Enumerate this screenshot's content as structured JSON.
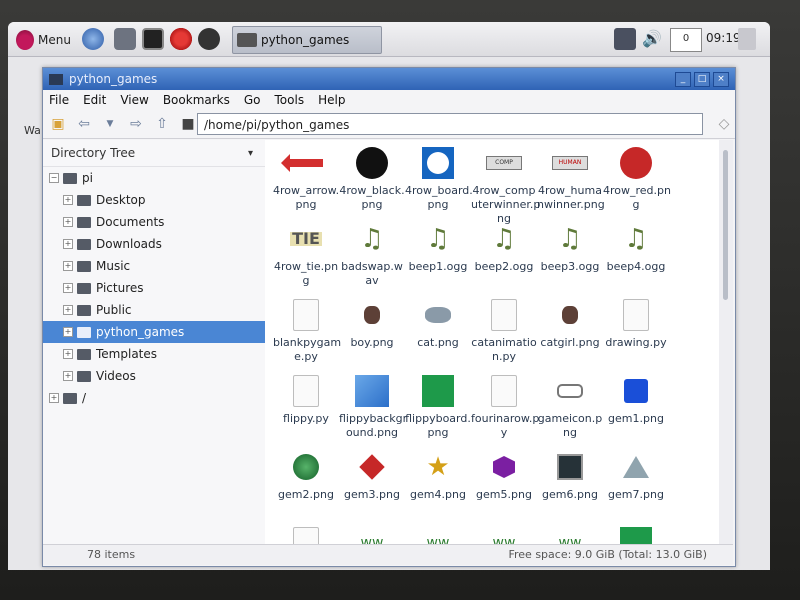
{
  "panel": {
    "menu_label": "Menu",
    "task_label": "python_games",
    "clock": "09:19",
    "tray_badge": "0"
  },
  "window": {
    "title": "python_games",
    "menu": [
      "File",
      "Edit",
      "View",
      "Bookmarks",
      "Go",
      "Tools",
      "Help"
    ],
    "path": "/home/pi/python_games"
  },
  "sidebar": {
    "header": "Directory Tree",
    "root": "pi",
    "items": [
      "Desktop",
      "Documents",
      "Downloads",
      "Music",
      "Pictures",
      "Public",
      "python_games",
      "Templates",
      "Videos"
    ],
    "fs_root": "/"
  },
  "files": [
    {
      "name": "4row_arrow.\npng",
      "icon": "arrow"
    },
    {
      "name": "4row_black.\npng",
      "icon": "black-circle"
    },
    {
      "name": "4row_board.\npng",
      "icon": "board"
    },
    {
      "name": "4row_comp\nuterwinner.p\nng",
      "icon": "banner"
    },
    {
      "name": "4row_huma\nnwinner.png",
      "icon": "banner2"
    },
    {
      "name": "4row_red.pn\ng",
      "icon": "red-circle"
    },
    {
      "name": "4row_tie.pn\ng",
      "icon": "tie"
    },
    {
      "name": "badswap.w\nav",
      "icon": "audio"
    },
    {
      "name": "beep1.ogg",
      "icon": "audio"
    },
    {
      "name": "beep2.ogg",
      "icon": "audio"
    },
    {
      "name": "beep3.ogg",
      "icon": "audio"
    },
    {
      "name": "beep4.ogg",
      "icon": "audio"
    },
    {
      "name": "blankpygam\ne.py",
      "icon": "doc"
    },
    {
      "name": "boy.png",
      "icon": "sprite"
    },
    {
      "name": "cat.png",
      "icon": "cat"
    },
    {
      "name": "catanimatio\nn.py",
      "icon": "doc"
    },
    {
      "name": "catgirl.png",
      "icon": "sprite"
    },
    {
      "name": "drawing.py",
      "icon": "doc"
    },
    {
      "name": "flippy.py",
      "icon": "doc"
    },
    {
      "name": "flippybackgr\nound.png",
      "icon": "blue-square"
    },
    {
      "name": "flippyboard.\npng",
      "icon": "green-square"
    },
    {
      "name": "fourinarow.p\ny",
      "icon": "doc"
    },
    {
      "name": "gameicon.p\nng",
      "icon": "gameicon"
    },
    {
      "name": "gem1.png",
      "icon": "gem-blue"
    },
    {
      "name": "gem2.png",
      "icon": "gem-green"
    },
    {
      "name": "gem3.png",
      "icon": "gem-red"
    },
    {
      "name": "gem4.png",
      "icon": "gem-star"
    },
    {
      "name": "gem5.png",
      "icon": "gem-purple"
    },
    {
      "name": "gem6.png",
      "icon": "gem-dark"
    },
    {
      "name": "gem7.png",
      "icon": "gem-tri"
    },
    {
      "name": "",
      "icon": "doc"
    },
    {
      "name": "",
      "icon": "grass"
    },
    {
      "name": "",
      "icon": "grass"
    },
    {
      "name": "",
      "icon": "grass"
    },
    {
      "name": "",
      "icon": "grass"
    },
    {
      "name": "",
      "icon": "green-square"
    }
  ],
  "status": {
    "items": "78 items",
    "free": "Free space: 9.0 GiB (Total: 13.0 GiB)"
  },
  "colors": {
    "titlebar": "#2f63b5",
    "selection": "#4a86d4"
  }
}
